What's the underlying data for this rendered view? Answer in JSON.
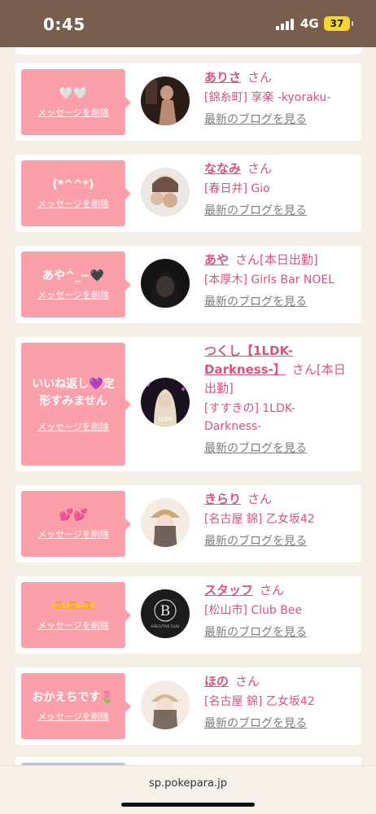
{
  "status_bar": {
    "time": "0:45",
    "network": "4G",
    "battery": "37"
  },
  "delete_label": "メッセージを削除",
  "blog_label": "最新のブログを見る",
  "honorific": "さん",
  "cards": [
    {
      "message": "🤍🤍",
      "name": "ありさ",
      "status": "",
      "shop": "[錦糸町] 享楽 -kyoraku-"
    },
    {
      "message": "(*^^*)",
      "name": "ななみ",
      "status": "",
      "shop": "[春日井] Gio"
    },
    {
      "message": "あや^_−🖤",
      "name": "あや",
      "status": "[本日出勤]",
      "shop": "[本厚木] Girls Bar NOEL"
    },
    {
      "message": "いいね返し💜定形すみません",
      "name": "つくし【1LDK-Darkness-】",
      "status": "[本日出勤]",
      "shop": "[すすきの] 1LDK-Darkness-"
    },
    {
      "message": "💕💕",
      "name": "きらり",
      "status": "",
      "shop": "[名古屋 錦] 乙女坂42"
    },
    {
      "message": "🫶🫶🫶",
      "name": "スタッフ",
      "status": "",
      "shop": "[松山市] Club Bee"
    },
    {
      "message": "おかえちです🌷",
      "name": "ほの",
      "status": "",
      "shop": "[名古屋 錦] 乙女坂42"
    }
  ],
  "avatar_badges": {
    "card3": "1LDK",
    "card5": "B",
    "card5_sub": "EXECUTIVE CLUB"
  },
  "colors": {
    "accent": "#d9537a",
    "bubble": "#fba0ab",
    "header": "#7a5e4d",
    "background": "#f6efe8"
  },
  "browser": {
    "url": "sp.pokepara.jp"
  }
}
